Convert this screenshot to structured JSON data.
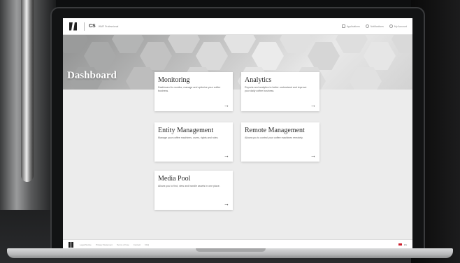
{
  "header": {
    "brand": "CS",
    "brand_sub": "WMF Professional",
    "links": [
      {
        "label": "Applications",
        "icon": "grid-icon"
      },
      {
        "label": "Notifications",
        "icon": "bell-icon"
      },
      {
        "label": "My Account",
        "icon": "user-icon"
      }
    ]
  },
  "page": {
    "title": "Dashboard"
  },
  "cards": [
    {
      "title": "Monitoring",
      "description": "Dashboard to monitor, manage and optimize your coffee business.",
      "arrow": "→"
    },
    {
      "title": "Analytics",
      "description": "Reports and analytics to better understand and improve your daily coffee business.",
      "arrow": "→"
    },
    {
      "title": "Entity Management",
      "description": "Manage your coffee machines, users, rights and roles.",
      "arrow": "→"
    },
    {
      "title": "Remote Management",
      "description": "Allows you to control your coffee machines remotely.",
      "arrow": "→"
    },
    {
      "title": "Media Pool",
      "description": "Allows you to find, view and handle assets in one place.",
      "arrow": "→"
    }
  ],
  "footer": {
    "links": [
      "Legal Notice",
      "Privacy Statement",
      "Terms of Use",
      "Contact",
      "FAQ"
    ],
    "language": "EN"
  },
  "colors": {
    "screen_bg": "#ececec",
    "card_bg": "#ffffff",
    "accent_flag": "#cc1f2d"
  }
}
